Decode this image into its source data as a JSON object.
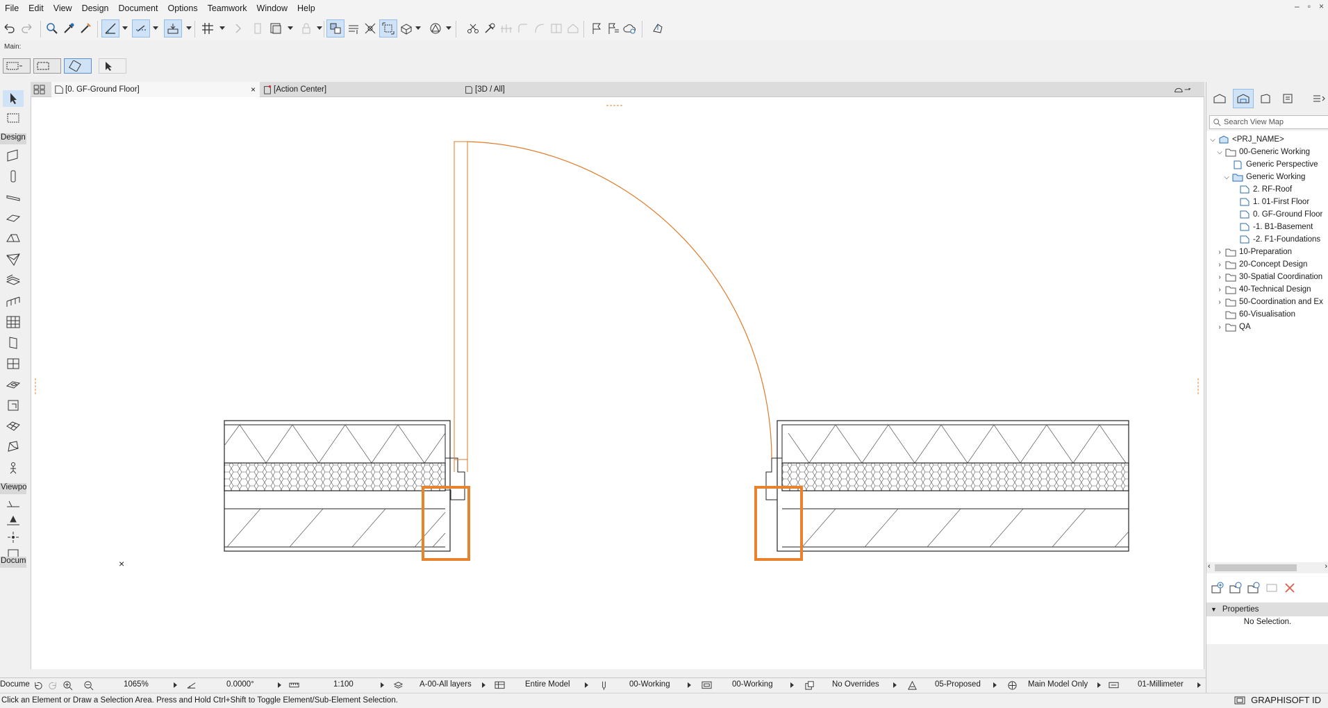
{
  "menubar": {
    "items": [
      "File",
      "Edit",
      "View",
      "Design",
      "Document",
      "Options",
      "Teamwork",
      "Window",
      "Help"
    ],
    "window_controls": [
      "–",
      "▫",
      "×"
    ]
  },
  "toolbar": {
    "main_label": "Main:"
  },
  "tabs": [
    {
      "label": "[0. GF-Ground Floor]",
      "close": "×",
      "icon": "floor-plan-icon"
    },
    {
      "label": "[Action Center]",
      "icon": "action-center-icon"
    },
    {
      "label": "[3D / All]",
      "icon": "3d-icon"
    }
  ],
  "toolbox": {
    "design_header": "Design",
    "viewpoint_header": "Viewpoi",
    "document_header": "Docume"
  },
  "canvas": {
    "origin_marker": "×"
  },
  "view_map": {
    "search_placeholder": "Search View Map",
    "tree": [
      {
        "label": "<PRJ_NAME>",
        "level": 0,
        "expanded": true,
        "icon": "project-icon"
      },
      {
        "label": "00-Generic Working",
        "level": 1,
        "expanded": true,
        "icon": "folder-icon"
      },
      {
        "label": "Generic Perspective",
        "level": 2,
        "icon": "perspective-icon"
      },
      {
        "label": "Generic Working",
        "level": 2,
        "expanded": true,
        "icon": "story-group-icon"
      },
      {
        "label": "2. RF-Roof",
        "level": 3,
        "icon": "story-icon"
      },
      {
        "label": "1. 01-First Floor",
        "level": 3,
        "icon": "story-icon"
      },
      {
        "label": "0. GF-Ground Floor",
        "level": 3,
        "icon": "story-icon"
      },
      {
        "label": "-1. B1-Basement",
        "level": 3,
        "icon": "story-icon"
      },
      {
        "label": "-2. F1-Foundations",
        "level": 3,
        "icon": "story-icon"
      },
      {
        "label": "10-Preparation",
        "level": 1,
        "expanded": false,
        "icon": "folder-icon"
      },
      {
        "label": "20-Concept Design",
        "level": 1,
        "expanded": false,
        "icon": "folder-icon"
      },
      {
        "label": "30-Spatial Coordination",
        "level": 1,
        "expanded": false,
        "icon": "folder-icon"
      },
      {
        "label": "40-Technical Design",
        "level": 1,
        "expanded": false,
        "icon": "folder-icon"
      },
      {
        "label": "50-Coordination and Ex",
        "level": 1,
        "expanded": false,
        "icon": "folder-icon"
      },
      {
        "label": "60-Visualisation",
        "level": 1,
        "icon": "folder-icon"
      },
      {
        "label": "QA",
        "level": 1,
        "expanded": false,
        "icon": "folder-icon"
      }
    ],
    "properties_label": "Properties",
    "properties_value": "No Selection."
  },
  "bottombar": {
    "zoom": "1065%",
    "angle": "0.0000°",
    "scale": "1:100",
    "layers": "A-00-All layers",
    "model": "Entire Model",
    "pen_set": "00-Working",
    "model_view": "00-Working",
    "overrides": "No Overrides",
    "renovation": "05-Proposed",
    "structural": "Main Model Only",
    "dimension": "01-Millimeter"
  },
  "status": {
    "text": "Click an Element or Draw a Selection Area. Press and Hold Ctrl+Shift to Toggle Element/Sub-Element Selection.",
    "brand": "GRAPHISOFT ID"
  },
  "colors": {
    "accent": "#cfe2f6",
    "selection_orange": "#e8822c",
    "door_line": "#e07a28"
  }
}
